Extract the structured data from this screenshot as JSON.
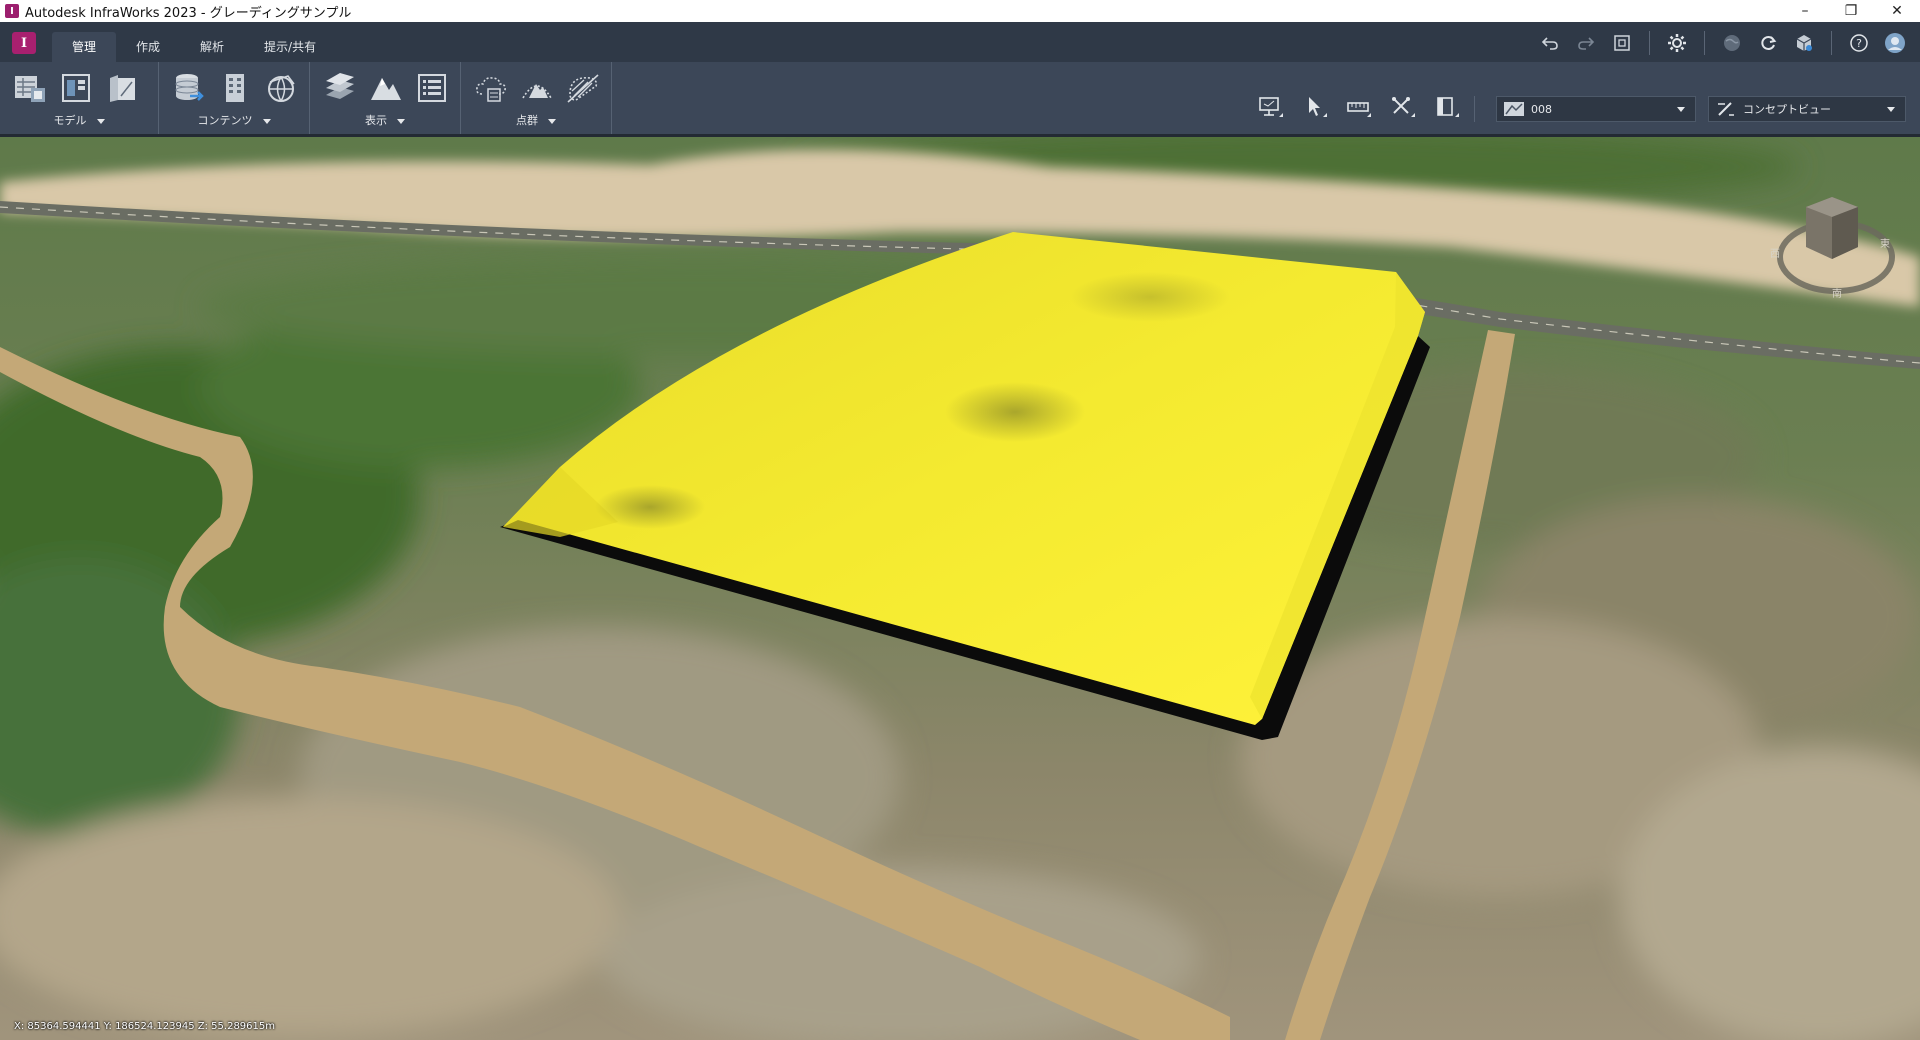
{
  "window": {
    "title": "Autodesk InfraWorks 2023 - グレーディングサンプル",
    "controls": {
      "minimize": "–",
      "maximize": "❐",
      "close": "✕"
    }
  },
  "app": {
    "logo_letter": "I",
    "brand_color": "#a8206f"
  },
  "tabs": [
    {
      "label": "管理",
      "active": true
    },
    {
      "label": "作成",
      "active": false
    },
    {
      "label": "解析",
      "active": false
    },
    {
      "label": "提示/共有",
      "active": false
    }
  ],
  "top_icons": [
    "undo-icon",
    "redo-icon",
    "fit-view-icon",
    "settings-icon",
    "globe-icon",
    "sync-icon",
    "cube-icon",
    "help-icon",
    "user-account-icon"
  ],
  "ribbon": {
    "groups": [
      {
        "label": "モデル",
        "icons": [
          "model-properties-icon",
          "data-panel-icon",
          "sheet-icon"
        ]
      },
      {
        "label": "コンテンツ",
        "icons": [
          "data-sources-icon",
          "building-icon",
          "model-explorer-icon"
        ]
      },
      {
        "label": "表示",
        "icons": [
          "layers-icon",
          "terrain-icon",
          "list-icon"
        ]
      },
      {
        "label": "点群",
        "icons": [
          "point-cloud-cloud-icon",
          "point-cloud-terrain-icon",
          "point-cloud-hatch-icon"
        ]
      }
    ],
    "tools": [
      "monitor-tool-icon",
      "select-tool-icon",
      "measure-tool-icon",
      "cross-tool-icon",
      "panel-tool-icon"
    ],
    "proposal_select": {
      "value": "008",
      "icon": "proposal-icon"
    },
    "visual_style_select": {
      "value": "コンセプトビュー",
      "icon": "visual-style-icon"
    }
  },
  "viewport": {
    "coordinates": "X: 85364.594441 Y: 186524.123945 Z: 55.289615m",
    "grading_color": "#ffe62e",
    "road_color": "#c4a877"
  }
}
